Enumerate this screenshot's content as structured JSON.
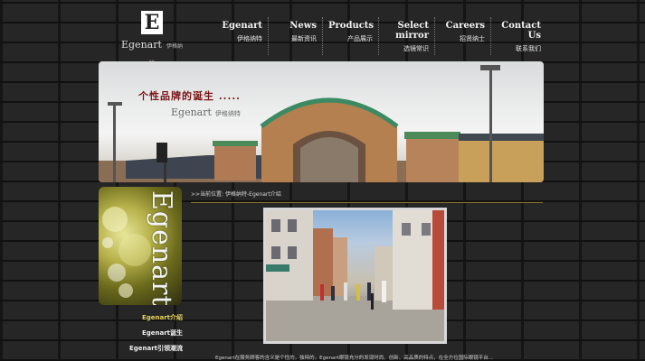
{
  "header": {
    "logo_letter": "E",
    "brand": "Egenart",
    "brand_cn": "伊格纳特"
  },
  "nav": [
    {
      "en": "Egenart",
      "cn": "伊格纳特"
    },
    {
      "en": "News",
      "cn": "最新资讯"
    },
    {
      "en": "Products",
      "cn": "产品展示"
    },
    {
      "en": "Select mirror",
      "cn": "选镜常识"
    },
    {
      "en": "Careers",
      "cn": "招贤纳士"
    },
    {
      "en": "Contact Us",
      "cn": "联系我们"
    }
  ],
  "banner": {
    "title": "个性品牌的诞生 .....",
    "brand": "Egenart",
    "brand_cn": "伊格纳特"
  },
  "sidebar": {
    "word": "Egenart",
    "items": [
      {
        "label": "Egenart介绍",
        "active": true
      },
      {
        "label": "Egenart诞生",
        "active": false
      },
      {
        "label": "Egenart引领潮流",
        "active": false
      }
    ]
  },
  "breadcrumb": ">>当前位置: 伊格纳特-Egenart介绍",
  "footer_text": "Egenart在服务顾客的含义是个性的，独特的，Egenart眼镜充分的发现时尚、创新、高品质的特点，在全方位国际眼镜平台..."
}
